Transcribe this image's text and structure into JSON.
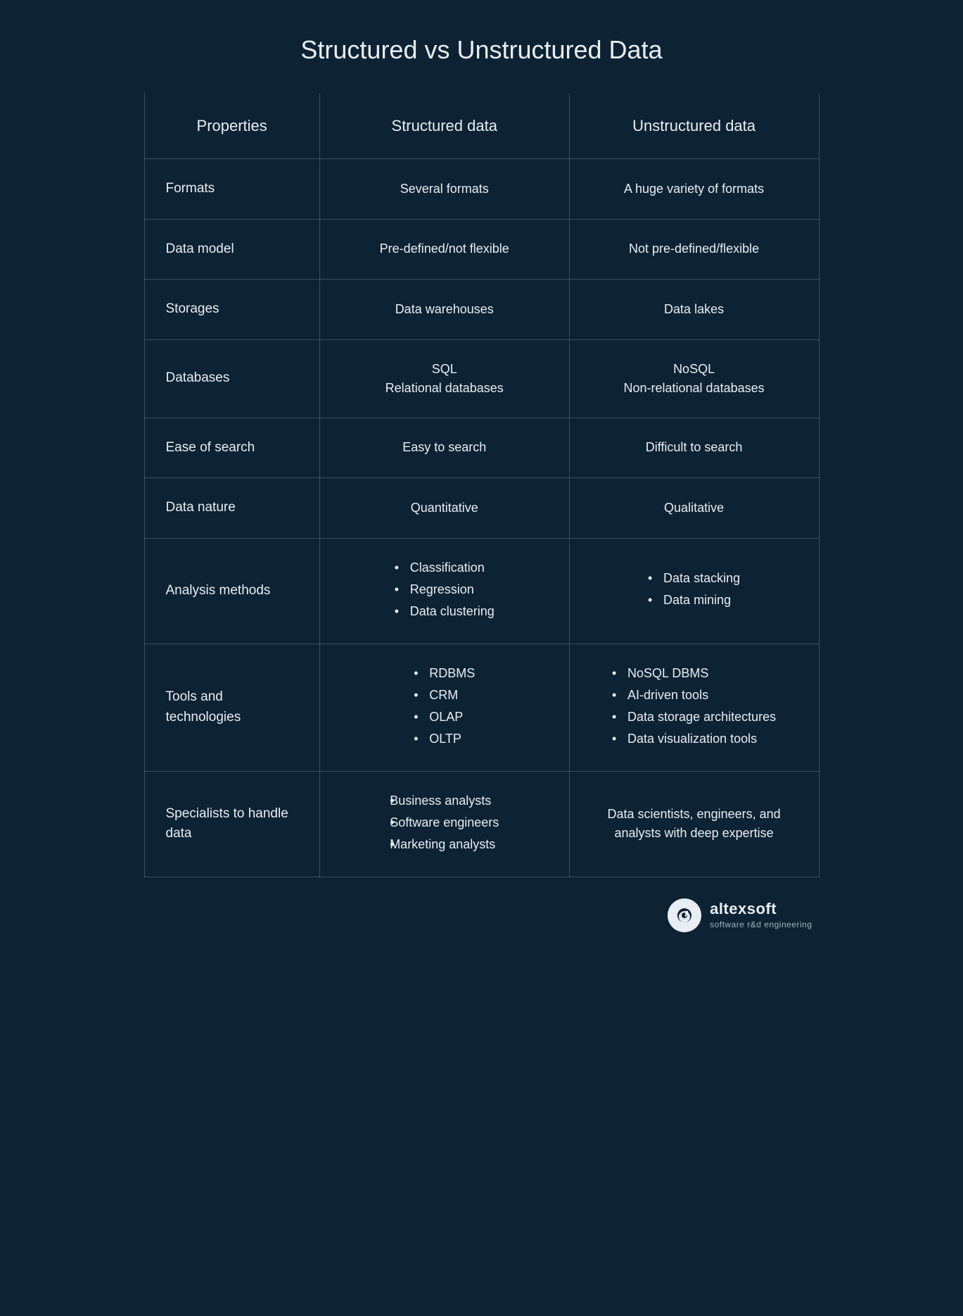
{
  "page": {
    "title": "Structured vs Unstructured Data"
  },
  "table": {
    "headers": {
      "properties": "Properties",
      "structured": "Structured data",
      "unstructured": "Unstructured data"
    },
    "rows": [
      {
        "property": "Formats",
        "structured": "Several formats",
        "unstructured": "A huge variety of formats",
        "type": "text"
      },
      {
        "property": "Data model",
        "structured": "Pre-defined/not flexible",
        "unstructured": "Not pre-defined/flexible",
        "type": "text"
      },
      {
        "property": "Storages",
        "structured": "Data warehouses",
        "unstructured": "Data lakes",
        "type": "text"
      },
      {
        "property": "Databases",
        "structured_list": [
          "SQL",
          "Relational databases"
        ],
        "unstructured_list": [
          "NoSQL",
          "Non-relational databases"
        ],
        "type": "multiline"
      },
      {
        "property": "Ease of search",
        "structured": "Easy to search",
        "unstructured": "Difficult to search",
        "type": "text"
      },
      {
        "property": "Data nature",
        "structured": "Quantitative",
        "unstructured": "Qualitative",
        "type": "text"
      },
      {
        "property": "Analysis methods",
        "structured_list": [
          "Classification",
          "Regression",
          "Data clustering"
        ],
        "unstructured_list": [
          "Data stacking",
          "Data mining"
        ],
        "type": "bullets"
      },
      {
        "property": "Tools and technologies",
        "structured_list": [
          "RDBMS",
          "CRM",
          "OLAP",
          "OLTP"
        ],
        "unstructured_list": [
          "NoSQL DBMS",
          "AI-driven tools",
          "Data storage architectures",
          "Data visualization tools"
        ],
        "type": "bullets"
      },
      {
        "property": "Specialists to handle data",
        "structured_list": [
          "Business analysts",
          "Software engineers",
          "Marketing analysts"
        ],
        "unstructured": "Data scientists, engineers, and analysts with deep expertise",
        "type": "mixed"
      }
    ]
  },
  "brand": {
    "name": "altexsoft",
    "tagline": "software r&d engineering"
  }
}
